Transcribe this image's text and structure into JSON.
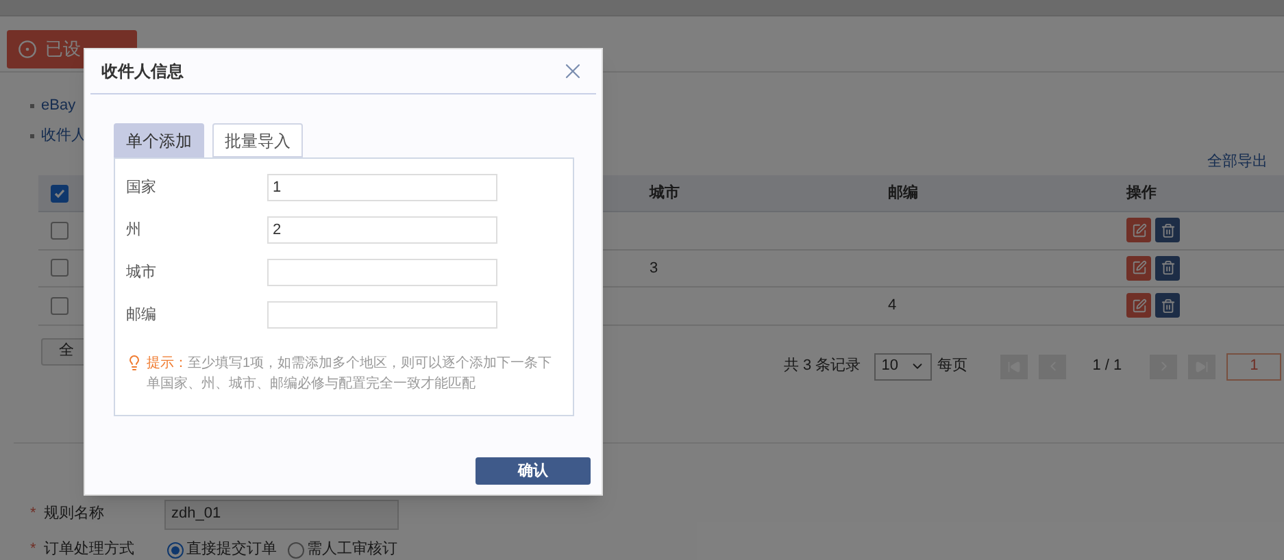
{
  "page": {
    "banner": "已设",
    "notes": [
      "eBay",
      "收件人"
    ],
    "export_link": "全部导出",
    "table": {
      "header_checked": true,
      "columns": [
        {
          "label": "城市"
        },
        {
          "label": "邮编"
        },
        {
          "label": "操作"
        }
      ],
      "rows": [
        {
          "checked": false
        },
        {
          "checked": false,
          "city": "3"
        },
        {
          "checked": false,
          "postcode": "4"
        }
      ]
    },
    "select_all": "全",
    "pagination": {
      "total": "共 3 条记录",
      "page_size": "10",
      "per_page": "每页",
      "pages": "1 / 1",
      "page_input": "1"
    },
    "form": {
      "rule_name": {
        "mark": "*",
        "label": "规则名称",
        "value": "zdh_01"
      },
      "handling": {
        "mark": "*",
        "label": "订单处理方式",
        "options": [
          {
            "label": "直接提交订单",
            "selected": true
          },
          {
            "label": "需人工审核订",
            "selected": false
          }
        ]
      }
    }
  },
  "dialog": {
    "title": "收件人信息",
    "tabs": [
      {
        "label": "单个添加",
        "selected": true
      },
      {
        "label": "批量导入",
        "selected": false
      }
    ],
    "fields": [
      {
        "label": "国家",
        "value": "1"
      },
      {
        "label": "州",
        "value": "2"
      },
      {
        "label": "城市"
      },
      {
        "label": "邮编"
      }
    ],
    "hint": {
      "label": "提示：",
      "text": "至少填写1项，如需添加多个地区，则可以逐个添加下一条下单国家、州、城市、邮编必修与配置完全一致才能匹配"
    },
    "confirm": "确认"
  }
}
